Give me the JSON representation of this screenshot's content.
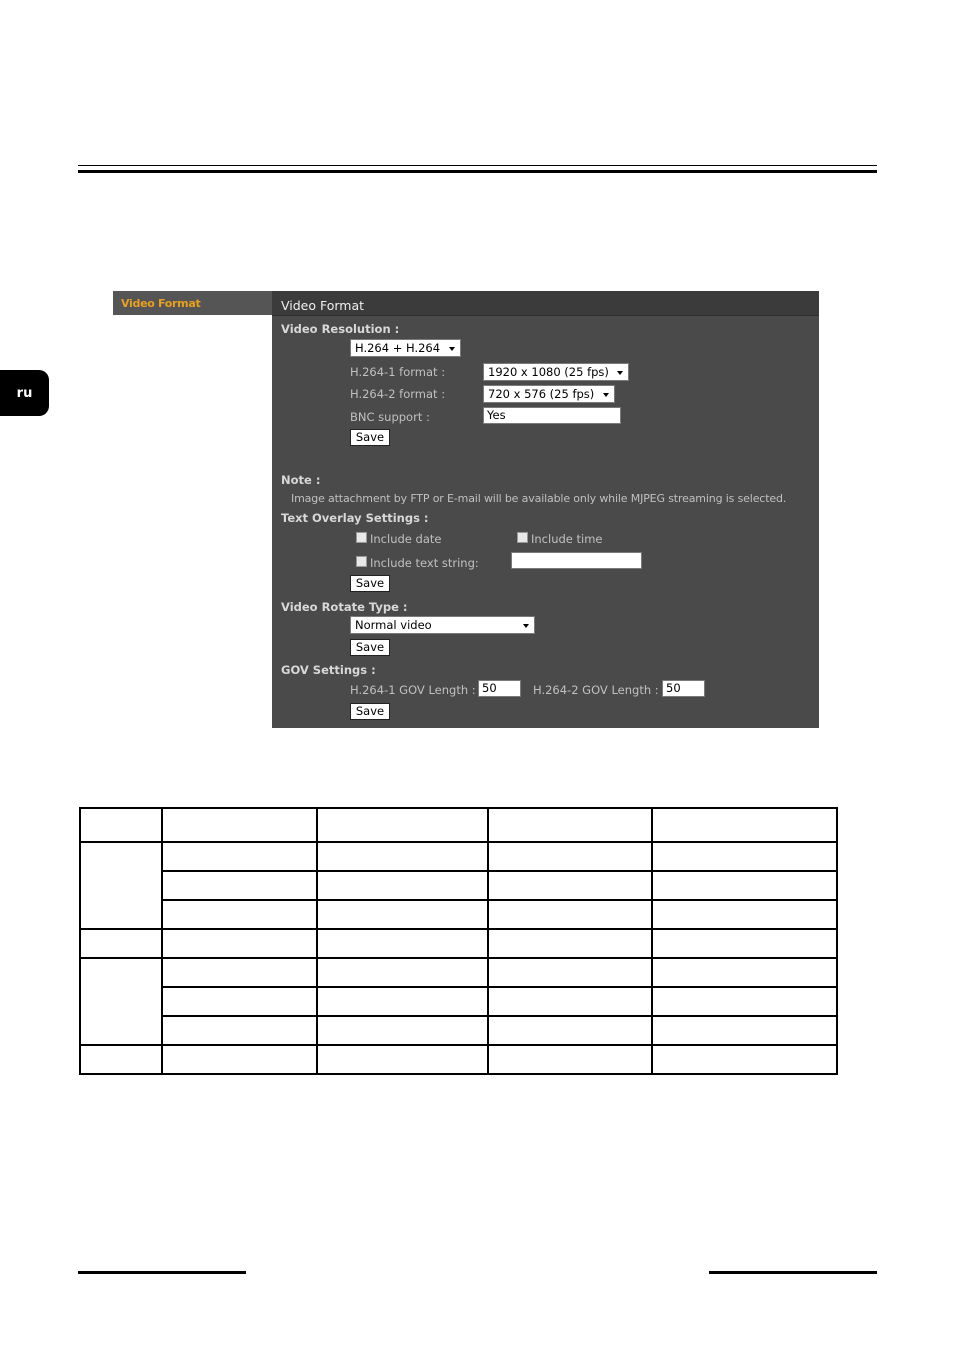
{
  "lang_tab": "ru",
  "side_menu": {
    "active_item": "Video Format"
  },
  "panel": {
    "title": "Video Format",
    "video_resolution": {
      "heading": "Video Resolution :",
      "mode_value": "H.264 + H.264",
      "h264_1_label": "H.264-1 format :",
      "h264_1_value": "1920 x 1080 (25 fps)",
      "h264_2_label": "H.264-2 format :",
      "h264_2_value": "720 x 576 (25 fps)",
      "bnc_label": "BNC support :",
      "bnc_value": "Yes",
      "save_label": "Save"
    },
    "note": {
      "heading": "Note :",
      "text": "Image attachment by FTP or E-mail will be available only while MJPEG streaming is selected."
    },
    "text_overlay": {
      "heading": "Text Overlay Settings :",
      "include_date": "Include date",
      "include_time": "Include time",
      "include_text": "Include text string:",
      "text_value": "",
      "save_label": "Save"
    },
    "rotate": {
      "heading": "Video Rotate Type :",
      "value": "Normal video",
      "save_label": "Save"
    },
    "gov": {
      "heading": "GOV Settings :",
      "h264_1_label": "H.264-1 GOV Length :",
      "h264_1_value": "50",
      "h264_2_label": "H.264-2 GOV Length :",
      "h264_2_value": "50",
      "save_label": "Save"
    }
  }
}
